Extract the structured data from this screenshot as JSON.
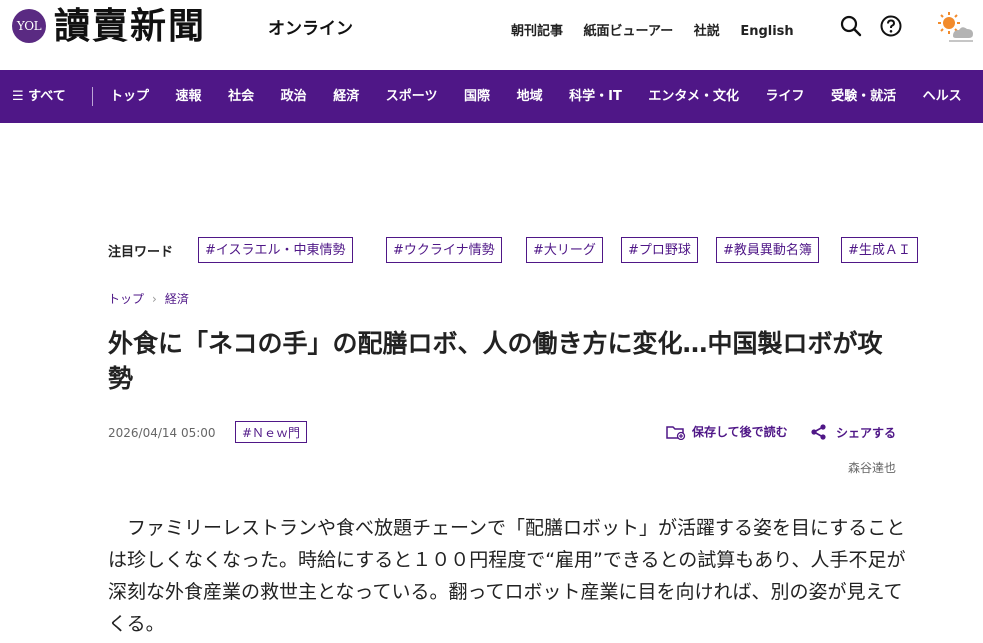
{
  "header": {
    "logo_badge": "YOL",
    "logo_title": "讀賣新聞",
    "logo_subtitle": "オンライン",
    "links": [
      "朝刊記事",
      "紙面ビューアー",
      "社説",
      "English"
    ]
  },
  "nav": {
    "all_label": "☰ すべて",
    "items": [
      "トップ",
      "速報",
      "社会",
      "政治",
      "経済",
      "スポーツ",
      "国際",
      "地域",
      "科学・IT",
      "エンタメ・文化",
      "ライフ",
      "受験・就活",
      "ヘルス"
    ]
  },
  "trending": {
    "label": "注目ワード",
    "tags": [
      "#イスラエル・中東情勢",
      "#ウクライナ情勢",
      "#大リーグ",
      "#プロ野球",
      "#教員異動名簿",
      "#生成ＡＩ"
    ]
  },
  "breadcrumb": [
    "トップ",
    "経済"
  ],
  "article": {
    "title": "外食に「ネコの手」の配膳ロボ、人の働き方に変化…中国製ロボが攻勢",
    "date": "2026/04/14 05:00",
    "tag": "#Ｎｅｗ門",
    "save_label": "保存して後で読む",
    "share_label": "シェアする",
    "author": "森谷達也",
    "body": "ファミリーレストランや食べ放題チェーンで「配膳ロボット」が活躍する姿を目にすることは珍しくなくなった。時給にすると１００円程度で“雇用”できるとの試算もあり、人手不足が深刻な外食産業の救世主となっている。翻ってロボット産業に目を向ければ、別の姿が見えてくる。"
  },
  "colors": {
    "brand": "#4f1787"
  }
}
